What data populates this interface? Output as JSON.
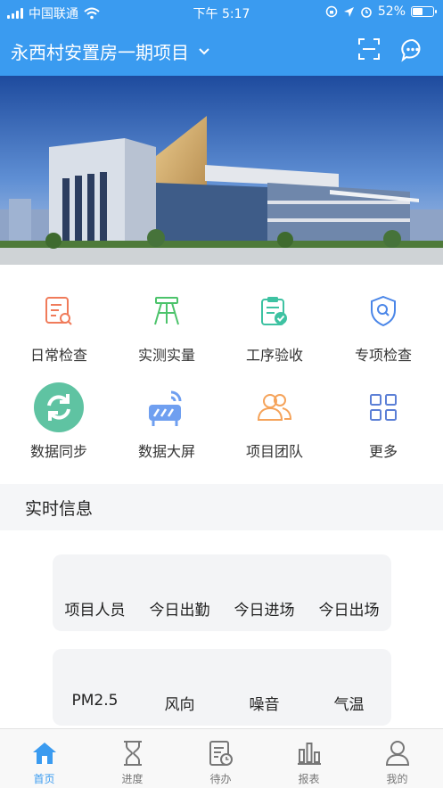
{
  "status_bar": {
    "carrier": "中国联通",
    "time": "下午 5:17",
    "battery": "52%",
    "battery_level": 0.52
  },
  "header": {
    "project_title": "永西村安置房一期项目",
    "icons": [
      "chevron-down-icon",
      "scan-icon",
      "message-icon"
    ]
  },
  "banner": {
    "image": "building-photo"
  },
  "menu": {
    "items": [
      {
        "label": "日常检查",
        "icon": "inspection-icon",
        "color": "#f07b5a"
      },
      {
        "label": "实测实量",
        "icon": "tripod-icon",
        "color": "#4cc36b"
      },
      {
        "label": "工序验收",
        "icon": "clipboard-check-icon",
        "color": "#3ec2a2"
      },
      {
        "label": "专项检查",
        "icon": "shield-search-icon",
        "color": "#4a86e8"
      },
      {
        "label": "数据同步",
        "icon": "sync-icon",
        "color": "#5fc3a2"
      },
      {
        "label": "数据大屏",
        "icon": "big-screen-icon",
        "color": "#6f9ff0"
      },
      {
        "label": "项目团队",
        "icon": "team-icon",
        "color": "#f5a35a"
      },
      {
        "label": "更多",
        "icon": "grid-icon",
        "color": "#5b7fd6"
      }
    ]
  },
  "realtime": {
    "title": "实时信息",
    "row1": [
      "项目人员",
      "今日出勤",
      "今日进场",
      "今日出场"
    ],
    "row2": [
      "PM2.5",
      "风向",
      "噪音",
      "气温"
    ]
  },
  "tabbar": {
    "tabs": [
      {
        "label": "首页",
        "icon": "home-icon",
        "active": true
      },
      {
        "label": "进度",
        "icon": "hourglass-icon",
        "active": false
      },
      {
        "label": "待办",
        "icon": "todo-icon",
        "active": false
      },
      {
        "label": "报表",
        "icon": "report-icon",
        "active": false
      },
      {
        "label": "我的",
        "icon": "profile-icon",
        "active": false
      }
    ]
  },
  "colors": {
    "primary": "#3a9bf0",
    "background": "#f5f6f8"
  }
}
